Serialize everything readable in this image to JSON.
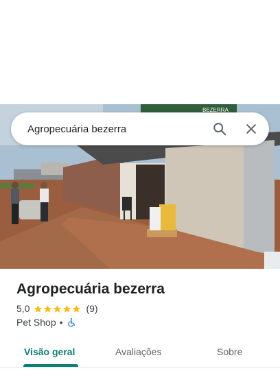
{
  "search": {
    "query": "Agropecuária bezerra"
  },
  "place": {
    "name": "Agropecuária bezerra",
    "rating": "5,0",
    "review_count": "(9)",
    "category": "Pet Shop",
    "separator": "•",
    "stars_filled": 5
  },
  "tabs": [
    {
      "label": "Visão geral",
      "active": true
    },
    {
      "label": "Avaliações",
      "active": false
    },
    {
      "label": "Sobre",
      "active": false
    }
  ],
  "photo": {
    "sign_text": "BEZERRA"
  },
  "colors": {
    "accent": "#0b7e73",
    "star": "#fbbc04",
    "accessibility": "#1a73e8"
  }
}
